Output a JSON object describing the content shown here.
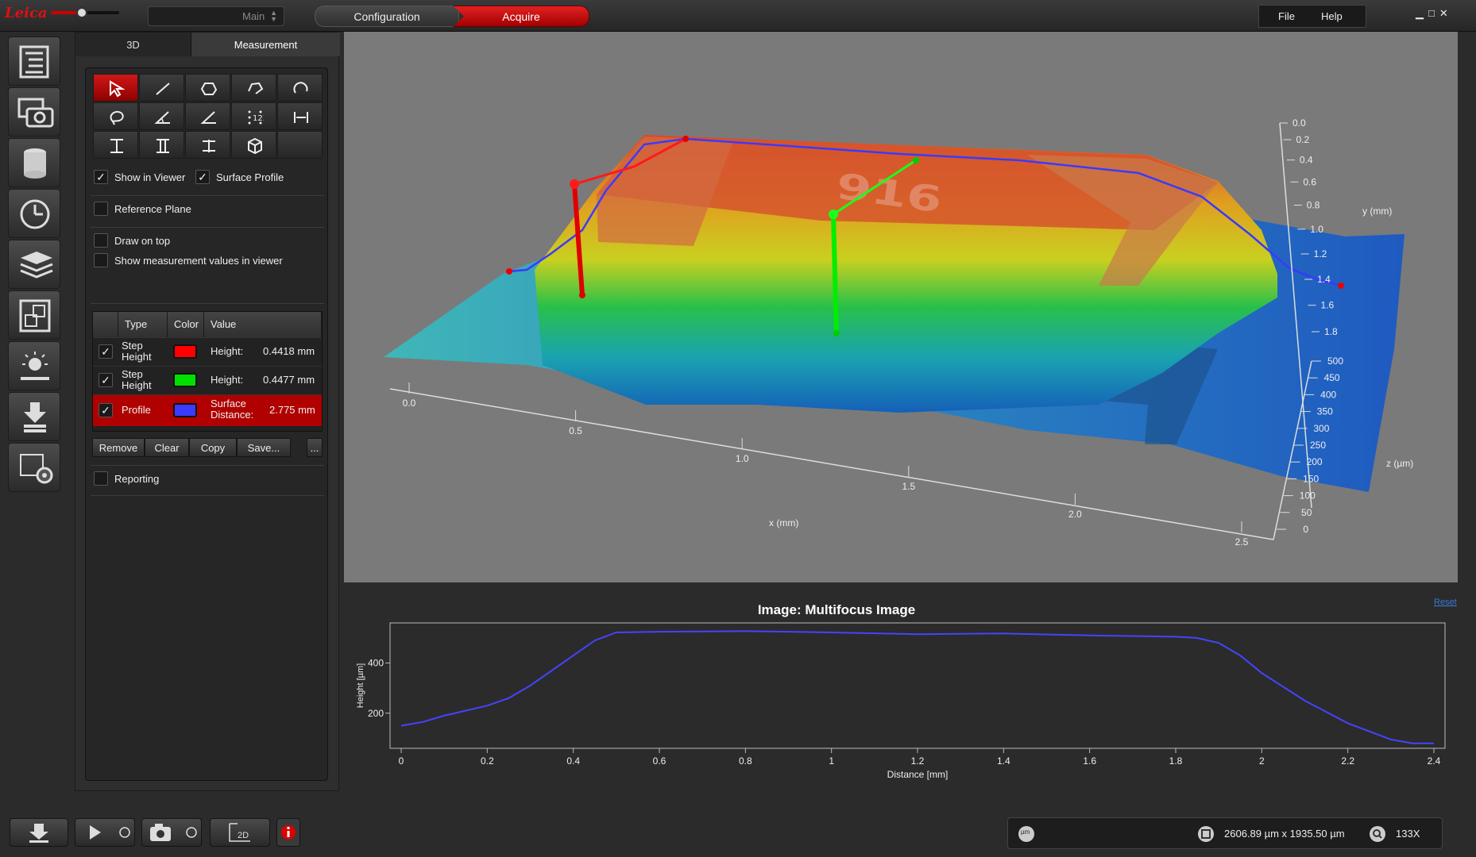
{
  "app": {
    "logo_text": "Leica",
    "workspace": "Main",
    "workflow_steps": [
      "Configuration",
      "Acquire"
    ],
    "active_step": "Acquire",
    "menu": {
      "file": "File",
      "help": "Help"
    },
    "accent_color": "#c8102e"
  },
  "rail": {
    "icons": [
      "tree-list-icon",
      "camera-icon",
      "cylinder-icon",
      "clock-icon",
      "layers-icon",
      "stitch-icon",
      "light-icon",
      "download-icon",
      "settings-icon"
    ],
    "active_index": 2
  },
  "panel": {
    "tabs": [
      "3D",
      "Measurement"
    ],
    "active_tab": "Measurement",
    "tools": [
      "select-arrow-icon",
      "line-icon",
      "polygon-icon",
      "polyline-icon",
      "arc-icon",
      "lasso-icon",
      "angle-icon",
      "angle2-icon",
      "point-count-icon",
      "distance-icon",
      "step-height-icon",
      "step-height2-icon",
      "step-height3-icon",
      "volume-icon"
    ],
    "options": {
      "show_in_viewer": {
        "label": "Show in Viewer",
        "checked": true
      },
      "surface_profile": {
        "label": "Surface Profile",
        "checked": true
      },
      "reference_plane": {
        "label": "Reference Plane",
        "checked": false
      },
      "draw_on_top": {
        "label": "Draw on top",
        "checked": false
      },
      "show_values": {
        "label": "Show measurement values in viewer",
        "checked": false
      },
      "reporting": {
        "label": "Reporting",
        "checked": false
      }
    },
    "table": {
      "headers": {
        "type": "Type",
        "color": "Color",
        "value": "Value"
      },
      "rows": [
        {
          "type": "Step Height",
          "color": "#ff0000",
          "label": "Height:",
          "value": "0.4418 mm",
          "checked": true,
          "selected": false
        },
        {
          "type": "Step Height",
          "color": "#00e000",
          "label": "Height:",
          "value": "0.4477 mm",
          "checked": true,
          "selected": false
        },
        {
          "type": "Profile",
          "color": "#3b3bff",
          "label": "Surface Distance:",
          "value": "2.775 mm",
          "checked": true,
          "selected": true
        }
      ]
    },
    "buttons": {
      "remove": "Remove",
      "clear": "Clear",
      "copy": "Copy",
      "save": "Save...",
      "more": "..."
    }
  },
  "viewer3d": {
    "x_axis": {
      "label": "x (mm)",
      "ticks": [
        "0.0",
        "0.5",
        "1.0",
        "1.5",
        "2.0",
        "2.5"
      ]
    },
    "y_axis": {
      "label": "y (mm)",
      "ticks": [
        "0.0",
        "0.2",
        "0.4",
        "0.6",
        "0.8",
        "1.0",
        "1.2",
        "1.4",
        "1.6",
        "1.8"
      ]
    },
    "z_axis": {
      "label": "z (µm)",
      "ticks": [
        "500",
        "450",
        "400",
        "350",
        "300",
        "250",
        "200",
        "150",
        "100",
        "50",
        "0"
      ]
    },
    "sample_marking": "916"
  },
  "profile_chart": {
    "title": "Image: Multifocus Image",
    "reset": "Reset",
    "line_color": "#4444ff"
  },
  "chart_data": {
    "type": "line",
    "title": "Image: Multifocus Image",
    "xlabel": "Distance [mm]",
    "ylabel": "Height [µm]",
    "xlim": [
      0,
      2.4
    ],
    "ylim": [
      60,
      560
    ],
    "x_ticks": [
      "0",
      "0.2",
      "0.4",
      "0.6",
      "0.8",
      "1",
      "1.2",
      "1.4",
      "1.6",
      "1.8",
      "2",
      "2.2",
      "2.4"
    ],
    "y_ticks": [
      "200",
      "400"
    ],
    "series": [
      {
        "x": [
          0,
          0.05,
          0.1,
          0.2,
          0.25,
          0.3,
          0.35,
          0.4,
          0.45,
          0.5,
          0.6,
          0.8,
          1.0,
          1.2,
          1.4,
          1.6,
          1.8,
          1.85,
          1.9,
          1.95,
          2.0,
          2.1,
          2.2,
          2.3,
          2.35,
          2.4
        ],
        "y": [
          150,
          165,
          190,
          230,
          260,
          310,
          370,
          430,
          490,
          522,
          525,
          527,
          522,
          515,
          518,
          510,
          505,
          500,
          480,
          430,
          360,
          250,
          160,
          95,
          80,
          80
        ]
      }
    ]
  },
  "status": {
    "unit": "µm",
    "dimensions": "2606.89 µm x 1935.50 µm",
    "zoom": "133X"
  },
  "bottom": {
    "mode_2d": "2D"
  }
}
